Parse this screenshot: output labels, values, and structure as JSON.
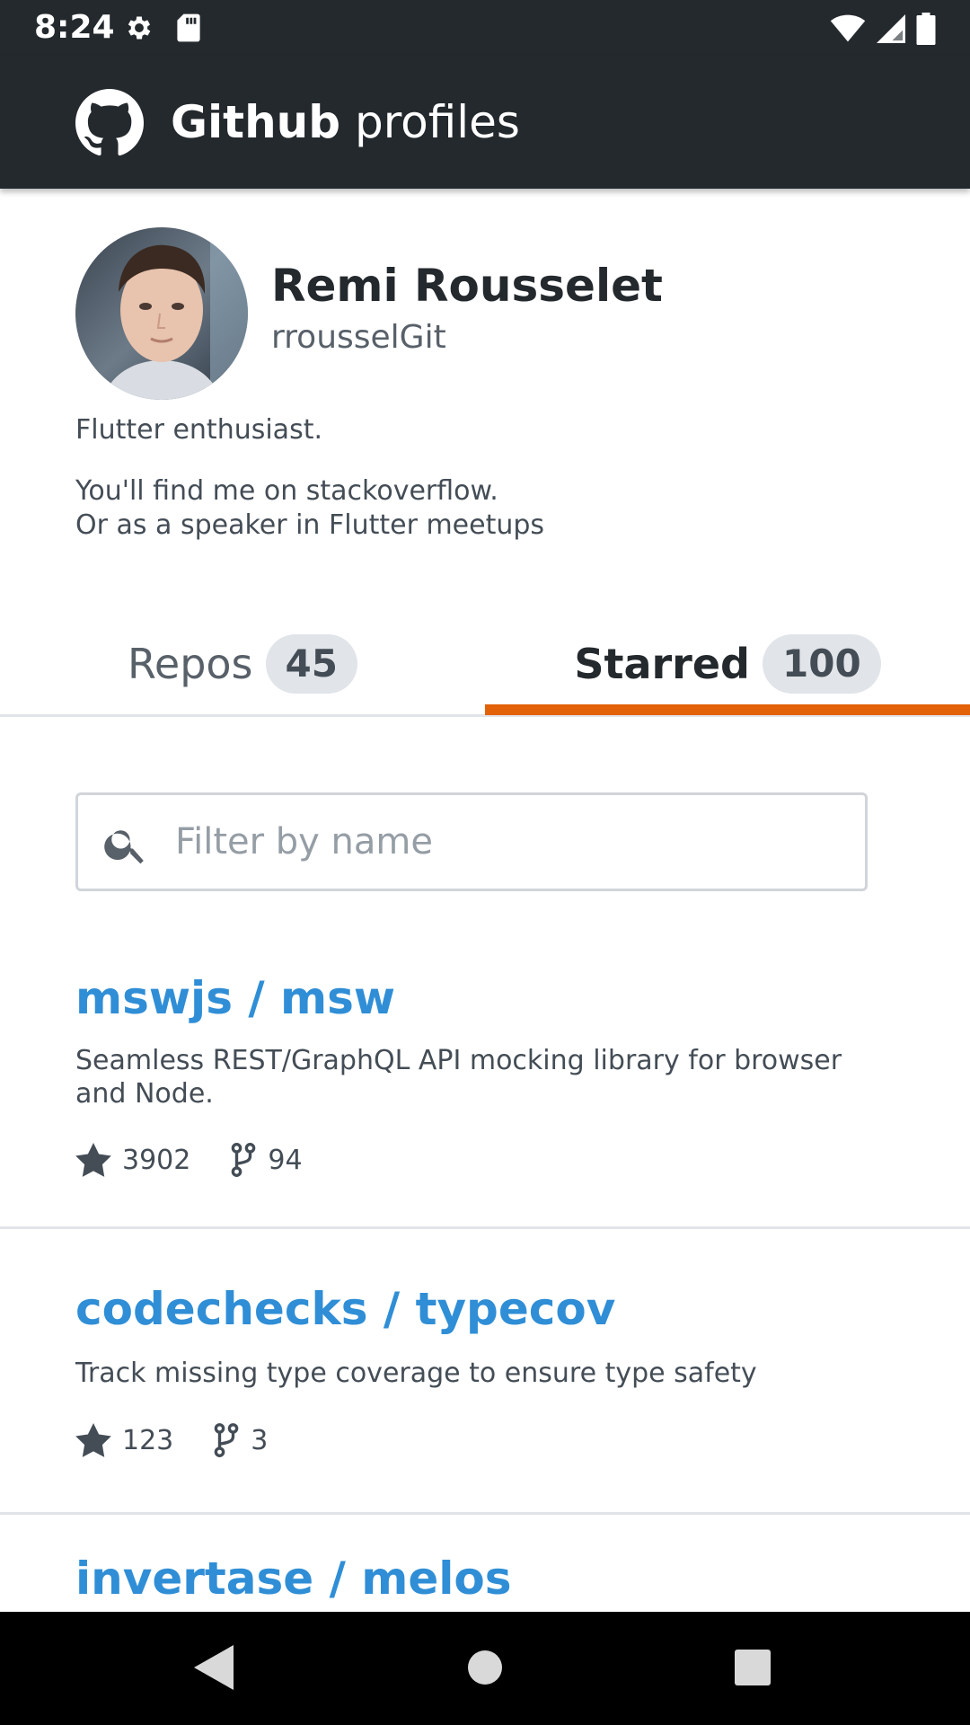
{
  "status_bar": {
    "time": "8:24",
    "icons_left": [
      "gear-icon",
      "sd-card-icon"
    ],
    "icons_right": [
      "wifi-icon",
      "signal-icon",
      "battery-icon"
    ]
  },
  "app_bar": {
    "logo_icon": "github-octocat-icon",
    "title_bold": "Github",
    "title_rest": " profiles"
  },
  "profile": {
    "name": "Remi Rousselet",
    "login": "rrousselGit",
    "bio": {
      "line1": "Flutter enthusiast.",
      "line2": "You'll find me on stackoverflow.",
      "line3": "Or as a speaker in Flutter meetups"
    }
  },
  "tabs": [
    {
      "label": "Repos",
      "count": "45",
      "selected": false
    },
    {
      "label": "Starred",
      "count": "100",
      "selected": true
    }
  ],
  "search": {
    "placeholder": "Filter by name",
    "value": ""
  },
  "repos": [
    {
      "name": "mswjs / msw",
      "description": "Seamless REST/GraphQL API mocking library for browser and Node.",
      "stars": "3902",
      "forks": "94"
    },
    {
      "name": "codechecks / typecov",
      "description": "Track missing type coverage to ensure type safety",
      "stars": "123",
      "forks": "3"
    },
    {
      "name": "invertase / melos"
    }
  ],
  "colors": {
    "header_bg": "#24292e",
    "tab_indicator": "#e36209",
    "repo_link": "#2f8ed6"
  }
}
